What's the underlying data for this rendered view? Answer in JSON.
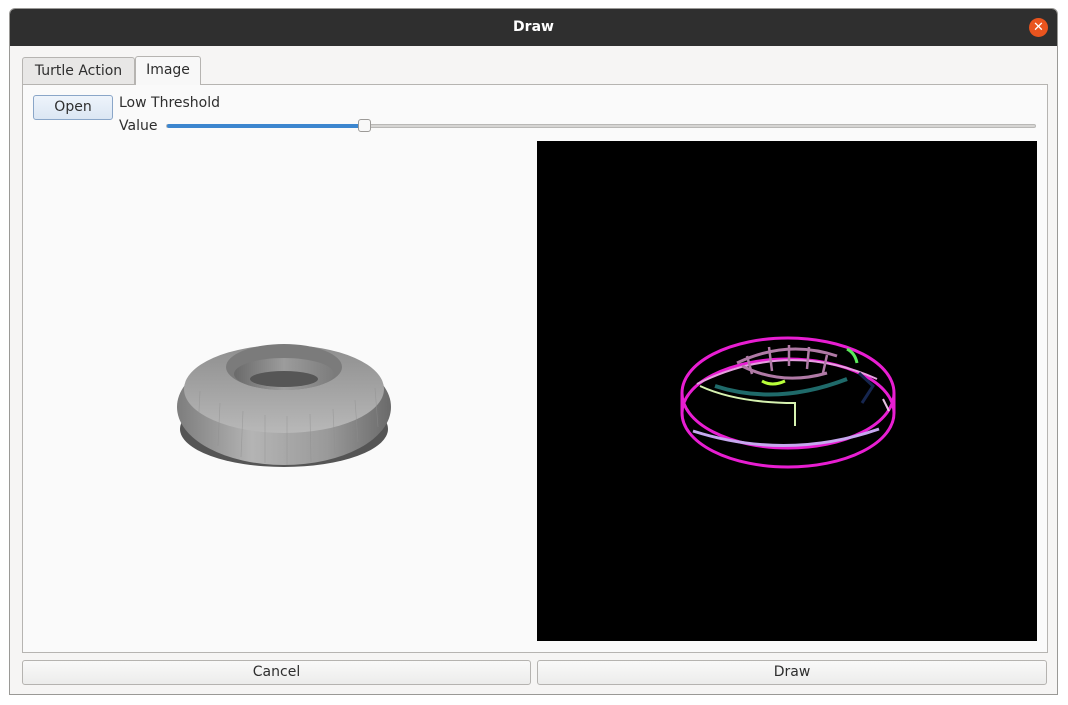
{
  "window": {
    "title": "Draw"
  },
  "tabs": [
    {
      "label": "Turtle Action",
      "active": false
    },
    {
      "label": "Image",
      "active": true
    }
  ],
  "controls": {
    "open_label": "Open",
    "threshold_label": "Low Threshold",
    "value_label": "Value",
    "slider_fraction": 0.227
  },
  "buttons": {
    "cancel": "Cancel",
    "draw": "Draw"
  },
  "colors": {
    "accent": "#3c86cf",
    "titlebar": "#2f2f2f",
    "close": "#e9541e",
    "edge_outline": "#e81ed2"
  },
  "icons": {
    "close": "close-icon"
  }
}
